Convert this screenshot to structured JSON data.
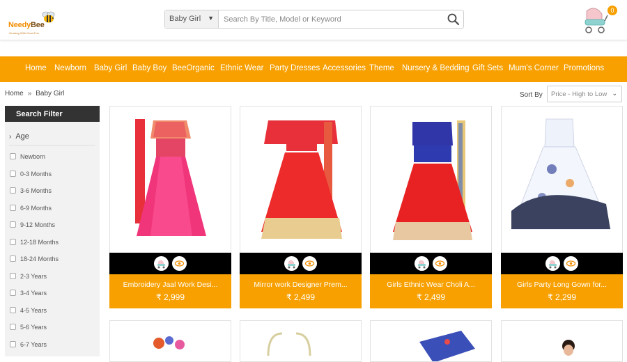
{
  "logo": {
    "name": "NeedyBee",
    "name_part1": "Needy",
    "name_part2": "Bee",
    "tagline": "Growing With Good Fun"
  },
  "search": {
    "category": "Baby Girl",
    "placeholder": "Search By Title, Model or Keyword"
  },
  "cart": {
    "count": "0"
  },
  "nav": {
    "items": [
      "Home",
      "Newborn",
      "Baby Girl",
      "Baby Boy",
      "BeeOrganic",
      "Ethnic Wear",
      "Party Dresses",
      "Accessories",
      "Theme",
      "Nursery & Bedding",
      "Gift Sets",
      "Mum's Corner",
      "Promotions"
    ]
  },
  "breadcrumb": {
    "home": "Home",
    "separator": "»",
    "current": "Baby Girl"
  },
  "sort": {
    "label": "Sort By",
    "selected": "Price - High to Low"
  },
  "filter": {
    "title": "Search Filter",
    "age_heading": "Age",
    "age_options": [
      "Newborn",
      "0-3 Months",
      "3-6 Months",
      "6-9 Months",
      "9-12 Months",
      "12-18 Months",
      "18-24 Months",
      "2-3 Years",
      "3-4 Years",
      "4-5 Years",
      "5-6 Years",
      "6-7 Years"
    ]
  },
  "products": [
    {
      "name": "Embroidery Jaal Work Desi...",
      "price": "₹ 2,999"
    },
    {
      "name": "Mirror work Designer Prem...",
      "price": "₹ 2,499"
    },
    {
      "name": "Girls Ethnic Wear Choli A...",
      "price": "₹ 2,499"
    },
    {
      "name": "Girls Party Long Gown for...",
      "price": "₹ 2,299"
    }
  ],
  "colors": {
    "accent": "#f7a000",
    "dark": "#333333"
  },
  "icons": {
    "search": "search-icon",
    "cart": "baby-stroller-icon",
    "quick_cart": "stroller-icon",
    "quick_view": "eye-icon"
  }
}
